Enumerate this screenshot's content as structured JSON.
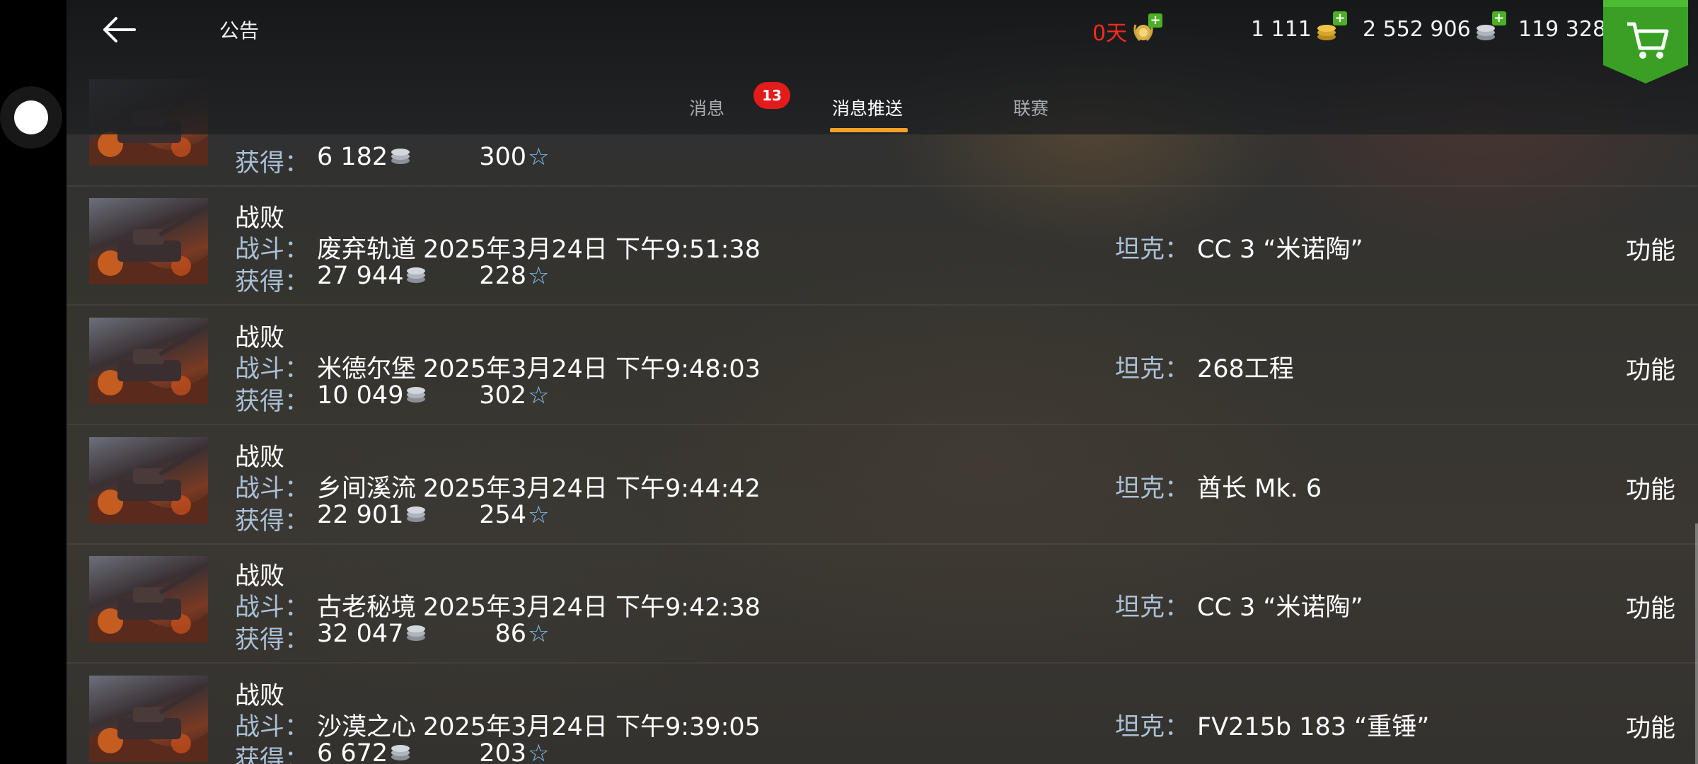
{
  "header": {
    "title": "公告",
    "currencies": [
      {
        "value": "0天",
        "icon": "premium-laurel-icon",
        "color": "#ff2a1c"
      },
      {
        "value": "1 111",
        "icon": "gold-icon",
        "color": "#f0f2f4"
      },
      {
        "value": "2 552 906",
        "icon": "silver-icon",
        "color": "#f0f2f4"
      },
      {
        "value": "119 328",
        "icon": "free-xp-star-icon",
        "color": "#f0f2f4"
      }
    ],
    "plus": "+"
  },
  "tabs": [
    {
      "label": "消息",
      "active": false
    },
    {
      "label": "消息推送",
      "active": true
    },
    {
      "label": "联赛",
      "active": false
    }
  ],
  "badge": "13",
  "labels": {
    "battle": "战斗：",
    "earned": "获得：",
    "tank": "坦克：",
    "action": "功能"
  },
  "rows": [
    {
      "result": "",
      "map": "",
      "datetime": "",
      "tank": "",
      "credits": "6 182",
      "xp": "300",
      "partial": true
    },
    {
      "result": "战败",
      "map": "废弃轨道",
      "datetime": "2025年3月24日 下午9:51:38",
      "tank": "CC 3 “米诺陶”",
      "credits": "27 944",
      "xp": "228"
    },
    {
      "result": "战败",
      "map": "米德尔堡",
      "datetime": "2025年3月24日 下午9:48:03",
      "tank": "268工程",
      "credits": "10 049",
      "xp": "302"
    },
    {
      "result": "战败",
      "map": "乡间溪流",
      "datetime": "2025年3月24日 下午9:44:42",
      "tank": "酋长 Mk. 6",
      "credits": "22 901",
      "xp": "254"
    },
    {
      "result": "战败",
      "map": "古老秘境",
      "datetime": "2025年3月24日 下午9:42:38",
      "tank": "CC 3 “米诺陶”",
      "credits": "32 047",
      "xp": "86"
    },
    {
      "result": "战败",
      "map": "沙漠之心",
      "datetime": "2025年3月24日 下午9:39:05",
      "tank": "FV215b 183 “重锤”",
      "credits": "6 672",
      "xp": "203"
    }
  ],
  "colors": {
    "accent": "#f2a127",
    "label": "#aac0d6",
    "badge": "#e31b1b",
    "cart": "#3aa025"
  }
}
